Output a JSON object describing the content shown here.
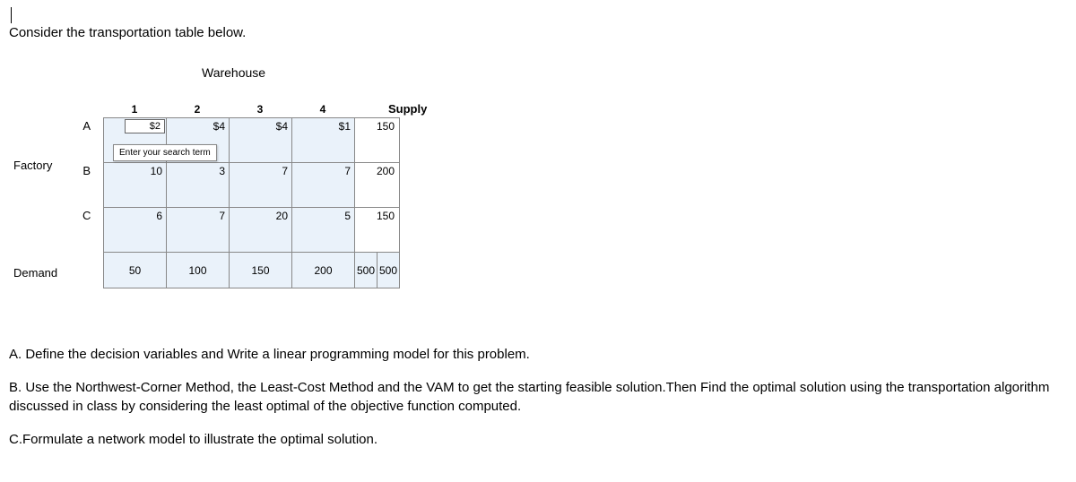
{
  "intro": "Consider the transportation table below.",
  "labels": {
    "warehouse": "Warehouse",
    "factory": "Factory",
    "demand": "Demand",
    "supply": "Supply",
    "rowA": "A",
    "rowB": "B",
    "rowC": "C",
    "col1": "1",
    "col2": "2",
    "col3": "3",
    "col4": "4"
  },
  "tooltip": "Enter your search term",
  "chart_data": {
    "type": "table",
    "rows": [
      "A",
      "B",
      "C"
    ],
    "cols": [
      "1",
      "2",
      "3",
      "4"
    ],
    "costs": {
      "A": [
        "$2",
        "$4",
        "$4",
        "$1"
      ],
      "B": [
        "10",
        "3",
        "7",
        "7"
      ],
      "C": [
        "6",
        "7",
        "20",
        "5"
      ]
    },
    "supply": {
      "A": "150",
      "B": "200",
      "C": "150"
    },
    "demand": [
      "50",
      "100",
      "150",
      "200"
    ],
    "totals": [
      "500",
      "500"
    ]
  },
  "questions": {
    "qA": "A.  Define the decision variables and Write a linear programming model for this problem.",
    "qB": "B. Use the Northwest-Corner Method, the Least-Cost Method and the VAM to get the starting feasible solution.Then Find the optimal solution using the transportation algorithm discussed in class by considering the least optimal of the objective function computed.",
    "qC": "C.Formulate a network model to illustrate the optimal solution."
  }
}
